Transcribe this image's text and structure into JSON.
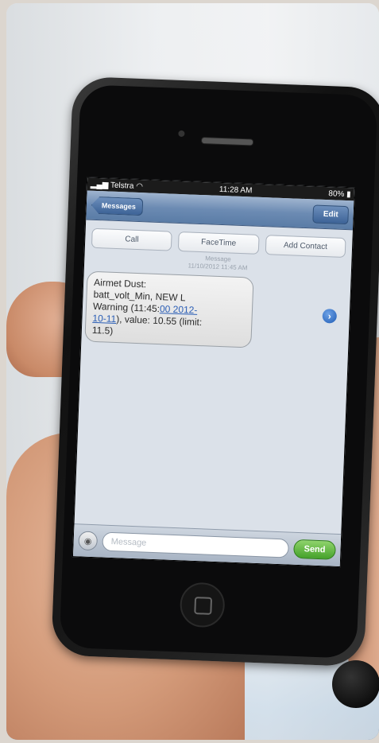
{
  "status_bar": {
    "carrier": "Telstra",
    "time": "11:28 AM",
    "battery": "80%"
  },
  "nav": {
    "back_label": "Messages",
    "edit_label": "Edit"
  },
  "actions": {
    "call": "Call",
    "facetime": "FaceTime",
    "add_contact": "Add Contact"
  },
  "message_meta": {
    "type": "Message",
    "timestamp": "11/10/2012 11:45 AM"
  },
  "message": {
    "line1": "Airmet Dust:",
    "line2": "batt_volt_Min, NEW L",
    "line3_prefix": "Warning (11:45:",
    "line3_link": "00 2012-",
    "line4_link": "10-11",
    "line4_suffix": "), value: 10.55 (limit:",
    "line5": "11.5)"
  },
  "composer": {
    "placeholder": "Message",
    "send_label": "Send"
  },
  "colors": {
    "nav_blue": "#6c8bb3",
    "send_green": "#45a22a",
    "link_blue": "#2c5fb6"
  }
}
